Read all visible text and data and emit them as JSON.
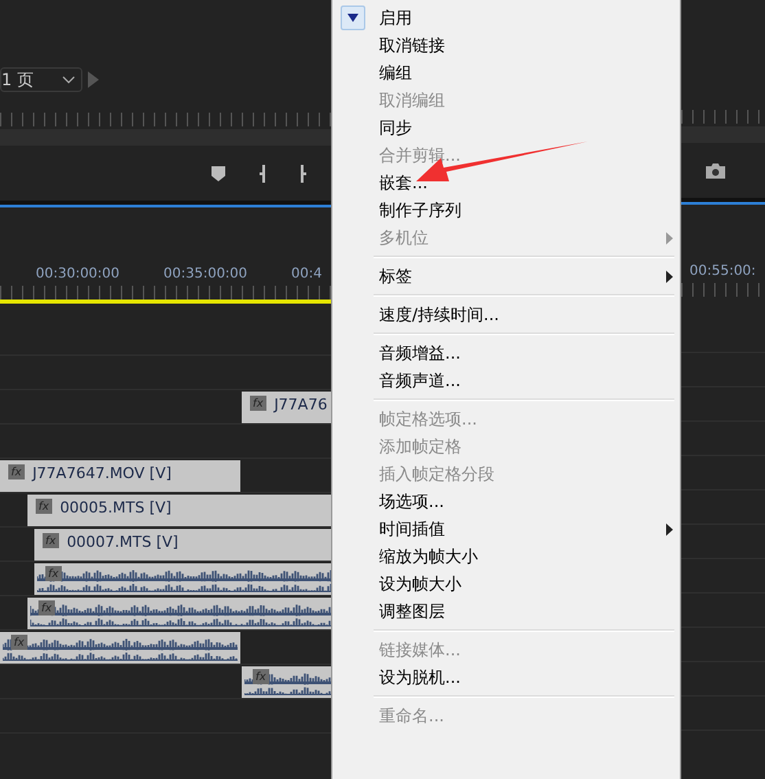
{
  "timeline": {
    "page_select": "1 页",
    "timecodes": [
      "00:30:00:00",
      "00:35:00:00",
      "00:4"
    ],
    "clips": [
      {
        "kind": "video",
        "badge": "fx",
        "label": "J77A76"
      },
      {
        "kind": "video",
        "badge": "fx",
        "label": "J77A7647.MOV [V]"
      },
      {
        "kind": "video",
        "badge": "fx",
        "label": "00005.MTS [V]"
      },
      {
        "kind": "video",
        "badge": "fx",
        "label": "00007.MTS [V]"
      },
      {
        "kind": "audio",
        "badge": "fx"
      },
      {
        "kind": "audio",
        "badge": "fx"
      },
      {
        "kind": "audio",
        "badge": "fx"
      },
      {
        "kind": "audio",
        "badge": "fx"
      }
    ]
  },
  "context_menu": {
    "items": [
      {
        "kind": "item",
        "label": "启用",
        "checked": true,
        "disabled": false,
        "submenu": false
      },
      {
        "kind": "item",
        "label": "取消链接",
        "checked": false,
        "disabled": false,
        "submenu": false
      },
      {
        "kind": "item",
        "label": "编组",
        "checked": false,
        "disabled": false,
        "submenu": false
      },
      {
        "kind": "item",
        "label": "取消编组",
        "checked": false,
        "disabled": true,
        "submenu": false
      },
      {
        "kind": "item",
        "label": "同步",
        "checked": false,
        "disabled": false,
        "submenu": false
      },
      {
        "kind": "item",
        "label": "合并剪辑...",
        "checked": false,
        "disabled": true,
        "submenu": false
      },
      {
        "kind": "item",
        "label": "嵌套...",
        "checked": false,
        "disabled": false,
        "submenu": false
      },
      {
        "kind": "item",
        "label": "制作子序列",
        "checked": false,
        "disabled": false,
        "submenu": false
      },
      {
        "kind": "item",
        "label": "多机位",
        "checked": false,
        "disabled": true,
        "submenu": true
      },
      {
        "kind": "separator"
      },
      {
        "kind": "item",
        "label": "标签",
        "checked": false,
        "disabled": false,
        "submenu": true
      },
      {
        "kind": "separator"
      },
      {
        "kind": "item",
        "label": "速度/持续时间...",
        "checked": false,
        "disabled": false,
        "submenu": false
      },
      {
        "kind": "separator"
      },
      {
        "kind": "item",
        "label": "音频增益...",
        "checked": false,
        "disabled": false,
        "submenu": false
      },
      {
        "kind": "item",
        "label": "音频声道...",
        "checked": false,
        "disabled": false,
        "submenu": false
      },
      {
        "kind": "separator"
      },
      {
        "kind": "item",
        "label": "帧定格选项...",
        "checked": false,
        "disabled": true,
        "submenu": false
      },
      {
        "kind": "item",
        "label": "添加帧定格",
        "checked": false,
        "disabled": true,
        "submenu": false
      },
      {
        "kind": "item",
        "label": "插入帧定格分段",
        "checked": false,
        "disabled": true,
        "submenu": false
      },
      {
        "kind": "item",
        "label": "场选项...",
        "checked": false,
        "disabled": false,
        "submenu": false
      },
      {
        "kind": "item",
        "label": "时间插值",
        "checked": false,
        "disabled": false,
        "submenu": true
      },
      {
        "kind": "item",
        "label": "缩放为帧大小",
        "checked": false,
        "disabled": false,
        "submenu": false
      },
      {
        "kind": "item",
        "label": "设为帧大小",
        "checked": false,
        "disabled": false,
        "submenu": false
      },
      {
        "kind": "item",
        "label": "调整图层",
        "checked": false,
        "disabled": false,
        "submenu": false
      },
      {
        "kind": "separator"
      },
      {
        "kind": "item",
        "label": "链接媒体...",
        "checked": false,
        "disabled": true,
        "submenu": false
      },
      {
        "kind": "item",
        "label": "设为脱机...",
        "checked": false,
        "disabled": false,
        "submenu": false
      },
      {
        "kind": "separator"
      },
      {
        "kind": "item",
        "label": "重命名...",
        "checked": false,
        "disabled": true,
        "submenu": false
      }
    ]
  },
  "right_panel": {
    "timecode": "00:55:00:"
  }
}
